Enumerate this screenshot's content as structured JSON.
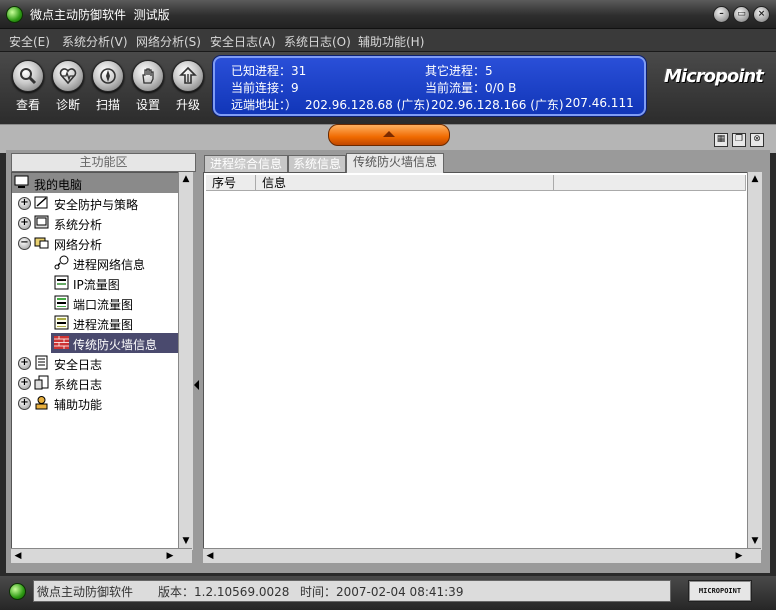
{
  "window": {
    "title": "微点主动防御软件  测试版",
    "controls": [
      "minimize",
      "restore",
      "close"
    ]
  },
  "menu": [
    {
      "label": "安全(E)"
    },
    {
      "label": "系统分析(V)"
    },
    {
      "label": "网络分析(S)"
    },
    {
      "label": "安全日志(A)"
    },
    {
      "label": "系统日志(O)"
    },
    {
      "label": "辅助功能(H)"
    }
  ],
  "toolbar": [
    {
      "label": "查看",
      "icon": "magnifier-icon"
    },
    {
      "label": "诊断",
      "icon": "heartbeat-icon"
    },
    {
      "label": "扫描",
      "icon": "scan-icon"
    },
    {
      "label": "设置",
      "icon": "hand-icon"
    },
    {
      "label": "升级",
      "icon": "upgrade-arrow-icon"
    }
  ],
  "info": {
    "known_processes": "已知进程：31",
    "other_processes": "其它进程：5",
    "current_connections": "当前连接：9",
    "current_traffic": "当前流量：0/0 B",
    "remote_prefix": "远端地址：）",
    "remote_address_1": "202.96.128.68 (广东)",
    "remote_address_2": "202.96.128.166 (广东)",
    "remote_address_3": "207.46.111"
  },
  "logo": "Micropoint",
  "left_panel": {
    "header": "主功能区",
    "tree": [
      {
        "label": "我的电脑",
        "icon": "computer-icon",
        "level": 0,
        "expander": ""
      },
      {
        "label": "安全防护与策略",
        "icon": "shield-policy-icon",
        "level": 1,
        "expander": "+"
      },
      {
        "label": "系统分析",
        "icon": "monitor-icon",
        "level": 1,
        "expander": "+"
      },
      {
        "label": "网络分析",
        "icon": "network-icon",
        "level": 1,
        "expander": "−"
      },
      {
        "label": "进程网络信息",
        "icon": "process-network-icon",
        "level": 2,
        "expander": ""
      },
      {
        "label": "IP流量图",
        "icon": "ip-chart-icon",
        "level": 2,
        "expander": ""
      },
      {
        "label": "端口流量图",
        "icon": "port-chart-icon",
        "level": 2,
        "expander": ""
      },
      {
        "label": "进程流量图",
        "icon": "process-chart-icon",
        "level": 2,
        "expander": ""
      },
      {
        "label": "传统防火墙信息",
        "icon": "firewall-icon",
        "level": 2,
        "expander": "",
        "selected": true
      },
      {
        "label": "安全日志",
        "icon": "security-log-icon",
        "level": 1,
        "expander": "+"
      },
      {
        "label": "系统日志",
        "icon": "system-log-icon",
        "level": 1,
        "expander": "+"
      },
      {
        "label": "辅助功能",
        "icon": "tools-icon",
        "level": 1,
        "expander": "+"
      }
    ]
  },
  "tabs": [
    {
      "label": "进程综合信息"
    },
    {
      "label": "系统信息"
    },
    {
      "label": "传统防火墙信息",
      "active": true
    }
  ],
  "table": {
    "columns": [
      "序号",
      "信息"
    ],
    "rows": []
  },
  "status": {
    "app_name": "微点主动防御软件",
    "version": "版本：1.2.10569.0028",
    "time": "时间：2007-02-04 08:41:39",
    "logo": "MICROPOINT"
  }
}
